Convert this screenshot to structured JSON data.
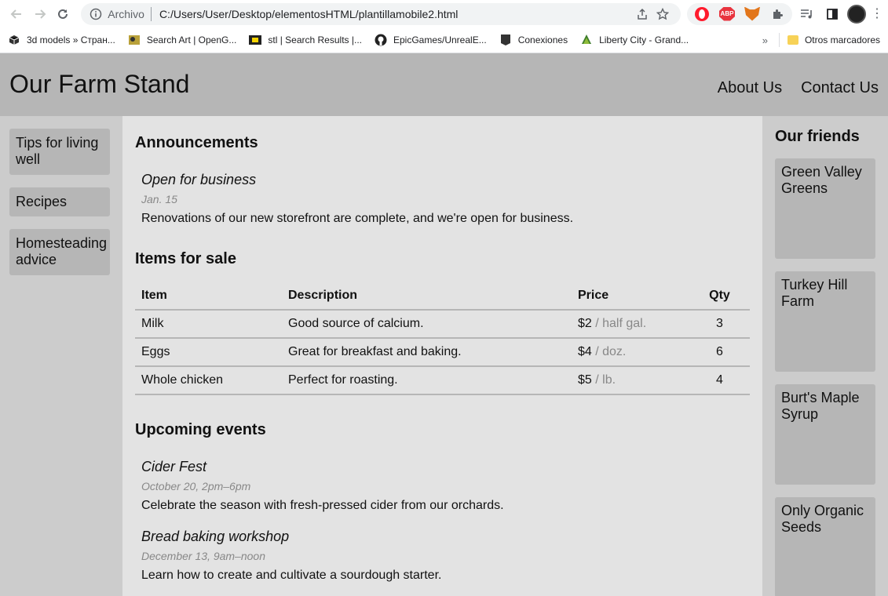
{
  "browser": {
    "address_prefix": "Archivo",
    "url": "C:/Users/User/Desktop/elementosHTML/plantillamobile2.html",
    "abp_label": "ABP",
    "bookmarks": [
      {
        "label": "3d models » Стран...",
        "icon": "cube-icon"
      },
      {
        "label": "Search Art | OpenG...",
        "icon": "opengameart-icon"
      },
      {
        "label": "stl | Search Results |...",
        "icon": "thingiverse-icon"
      },
      {
        "label": "EpicGames/UnrealE...",
        "icon": "github-icon"
      },
      {
        "label": "Conexiones",
        "icon": "epic-icon"
      },
      {
        "label": "Liberty City - Grand...",
        "icon": "tree-icon"
      }
    ],
    "bookmarks_more": "»",
    "other_bookmarks": "Otros marcadores"
  },
  "header": {
    "title": "Our Farm Stand",
    "nav": [
      "About Us",
      "Contact Us"
    ]
  },
  "left_nav": [
    "Tips for living well",
    "Recipes",
    "Homesteading advice"
  ],
  "announcements": {
    "heading": "Announcements",
    "items": [
      {
        "title": "Open for business",
        "date": "Jan. 15",
        "text": "Renovations of our new storefront are complete, and we're open for business."
      }
    ]
  },
  "items_for_sale": {
    "heading": "Items for sale",
    "columns": [
      "Item",
      "Description",
      "Price",
      "Qty"
    ],
    "rows": [
      {
        "item": "Milk",
        "description": "Good source of calcium.",
        "price": "$2",
        "unit": " / half gal.",
        "qty": "3"
      },
      {
        "item": "Eggs",
        "description": "Great for breakfast and baking.",
        "price": "$4",
        "unit": " / doz.",
        "qty": "6"
      },
      {
        "item": "Whole chicken",
        "description": "Perfect for roasting.",
        "price": "$5",
        "unit": " / lb.",
        "qty": "4"
      }
    ]
  },
  "events": {
    "heading": "Upcoming events",
    "items": [
      {
        "title": "Cider Fest",
        "date": "October 20, 2pm–6pm",
        "text": "Celebrate the season with fresh-pressed cider from our orchards."
      },
      {
        "title": "Bread baking workshop",
        "date": "December 13, 9am–noon",
        "text": "Learn how to create and cultivate a sourdough starter."
      }
    ]
  },
  "friends": {
    "heading": "Our friends",
    "items": [
      "Green Valley Greens",
      "Turkey Hill Farm",
      "Burt's Maple Syrup",
      "Only Organic Seeds"
    ]
  }
}
